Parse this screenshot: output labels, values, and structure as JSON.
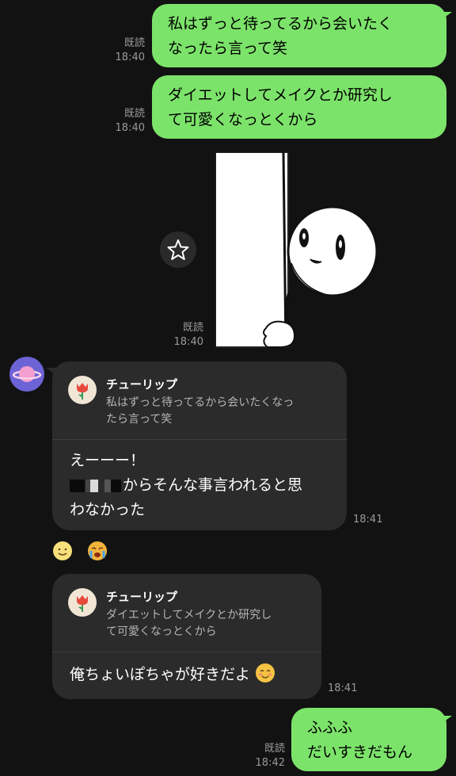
{
  "messages_out": [
    {
      "read": "既読",
      "time": "18:40",
      "lines": [
        "私はずっと待ってるから会いたく",
        "なったら言って笑"
      ]
    },
    {
      "read": "既読",
      "time": "18:40",
      "lines": [
        "ダイエットしてメイクとか研究し",
        "て可愛くなっとくから"
      ]
    },
    {
      "read": "既読",
      "time": "18:42",
      "lines": [
        "ふふふ",
        "だいすきだもん"
      ]
    }
  ],
  "sticker": {
    "read": "既読",
    "time": "18:40"
  },
  "incoming": [
    {
      "reply_name": "チューリップ",
      "reply_lines": [
        "私はずっと待ってるから会いたくなっ",
        "たら言って笑"
      ],
      "lines": [
        "えーーー！",
        "からそんな事言われると思",
        "わなかった"
      ],
      "time": "18:41"
    },
    {
      "reply_name": "チューリップ",
      "reply_lines": [
        "ダイエットしてメイクとか研究し",
        "て可愛くなっとくから"
      ],
      "lines": [
        "俺ちょいぽちゃが好きだよ"
      ],
      "time": "18:41"
    }
  ],
  "colors": {
    "background": "#121212",
    "outgoing_bubble": "#7ce36a",
    "incoming_bubble": "#2b2b2b"
  }
}
